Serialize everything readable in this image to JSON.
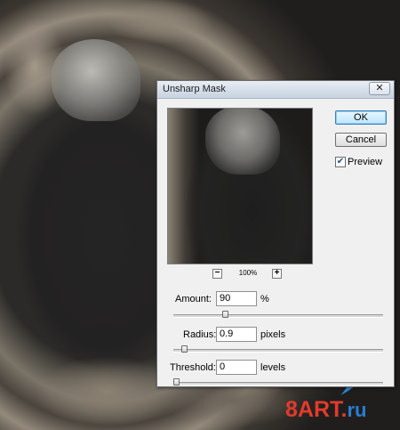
{
  "dialog": {
    "title": "Unsharp Mask",
    "close_glyph": "✕",
    "ok_label": "OK",
    "cancel_label": "Cancel",
    "preview_label": "Preview",
    "preview_checked": true,
    "zoom_level": "100%",
    "zoom_out_glyph": "−",
    "zoom_in_glyph": "+"
  },
  "fields": {
    "amount": {
      "label": "Amount:",
      "value": "90",
      "unit": "%",
      "slider_fraction": 0.24
    },
    "radius": {
      "label": "Radius:",
      "value": "0.9",
      "unit": "pixels",
      "slider_fraction": 0.04
    },
    "threshold": {
      "label": "Threshold:",
      "value": "0",
      "unit": "levels",
      "slider_fraction": 0.0
    }
  },
  "watermark": {
    "brand": "8ART",
    "dot": ".",
    "tld": "ru"
  },
  "colors": {
    "ok_accent": "#3c7fb1",
    "watermark_red": "#e33a2c",
    "watermark_blue": "#2b7cd0"
  }
}
